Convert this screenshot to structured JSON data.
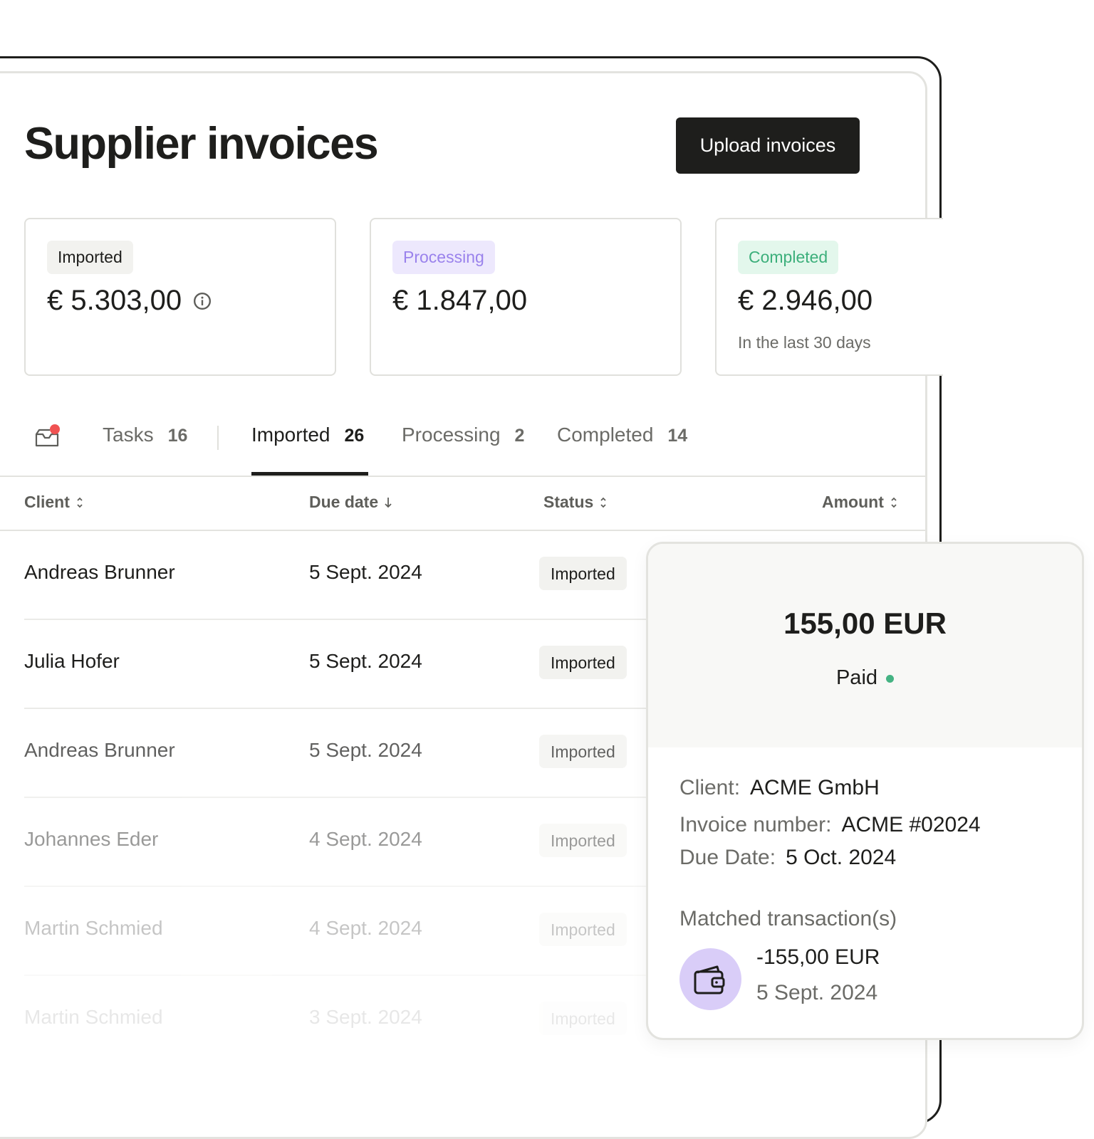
{
  "header": {
    "title": "Supplier invoices",
    "upload_label": "Upload invoices"
  },
  "stats": [
    {
      "badge": "Imported",
      "amount": "€ 5.303,00",
      "icon": "info-icon",
      "sub": ""
    },
    {
      "badge": "Processing",
      "amount": "€ 1.847,00",
      "sub": ""
    },
    {
      "badge": "Completed",
      "amount": "€ 2.946,00",
      "sub": "In the last 30 days"
    }
  ],
  "tabs": {
    "inbox_icon": "inbox-icon",
    "items": [
      {
        "label": "Tasks",
        "count": "16"
      },
      {
        "label": "Imported",
        "count": "26",
        "active": true
      },
      {
        "label": "Processing",
        "count": "2"
      },
      {
        "label": "Completed",
        "count": "14"
      }
    ]
  },
  "table": {
    "columns": [
      {
        "label": "Client",
        "sort": "sortable"
      },
      {
        "label": "Due date",
        "sort": "descending"
      },
      {
        "label": "Status",
        "sort": "sortable"
      },
      {
        "label": "Amount",
        "sort": "sortable"
      }
    ],
    "rows": [
      {
        "client": "Andreas Brunner",
        "due_date": "5 Sept. 2024",
        "status": "Imported"
      },
      {
        "client": "Julia Hofer",
        "due_date": "5 Sept. 2024",
        "status": "Imported"
      },
      {
        "client": "Andreas Brunner",
        "due_date": "5 Sept. 2024",
        "status": "Imported"
      },
      {
        "client": "Johannes Eder",
        "due_date": "4 Sept. 2024",
        "status": "Imported"
      },
      {
        "client": "Martin Schmied",
        "due_date": "4 Sept. 2024",
        "status": "Imported"
      },
      {
        "client": "Martin Schmied",
        "due_date": "3 Sept. 2024",
        "status": "Imported"
      }
    ]
  },
  "detail": {
    "amount": "155,00 EUR",
    "status": "Paid",
    "status_color": "#45b383",
    "client_label": "Client:",
    "client_value": "ACME GmbH",
    "invoice_label": "Invoice number:",
    "invoice_value": "ACME #02024",
    "due_label": "Due Date:",
    "due_value": "5 Oct. 2024",
    "matched_label": "Matched transaction(s)",
    "transaction": {
      "icon": "wallet-icon",
      "amount": "-155,00 EUR",
      "date": "5 Sept. 2024"
    }
  },
  "colors": {
    "accent_dark": "#1e1e1c",
    "processing": "#9a82ec",
    "completed": "#3caf7b",
    "notification": "#f05252"
  }
}
